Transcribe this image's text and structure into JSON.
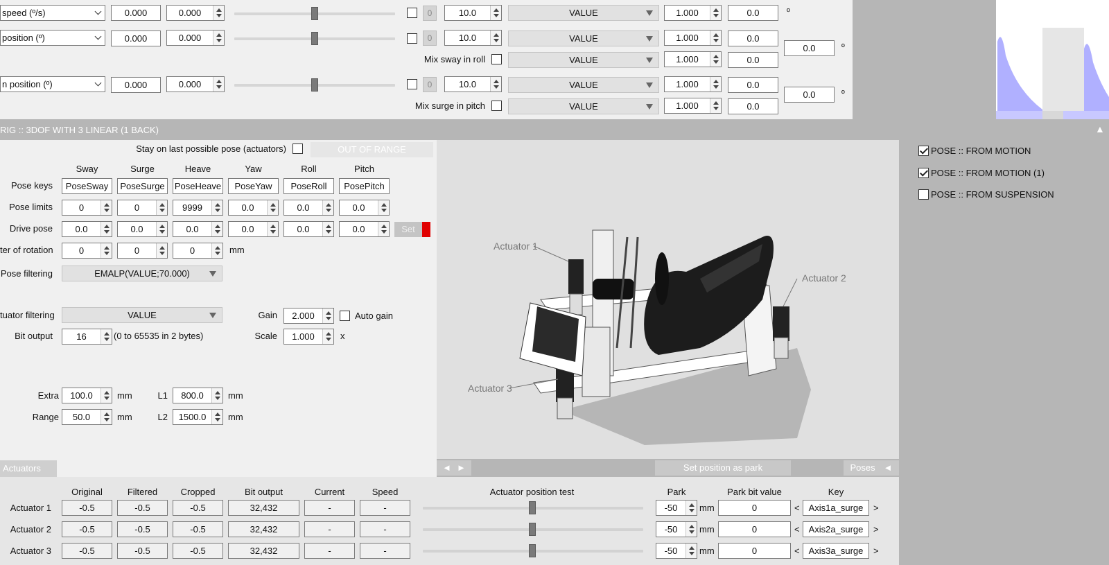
{
  "top": {
    "rows": [
      {
        "axis": "speed (º/s)",
        "a": "0.000",
        "b": "0.000",
        "zero": "0",
        "gain": "10.0",
        "filter": "VALUE",
        "mult": "1.000",
        "out": "0.0"
      },
      {
        "axis": "position (º)",
        "a": "0.000",
        "b": "0.000",
        "zero": "0",
        "gain": "10.0",
        "filter": "VALUE",
        "mult": "1.000",
        "out": "0.0"
      },
      {
        "axis": "n position (º)",
        "a": "0.000",
        "b": "0.000",
        "zero": "0",
        "gain": "10.0",
        "filter": "VALUE",
        "mult": "1.000",
        "out": "0.0"
      }
    ],
    "mix_sway_label": "Mix sway in roll",
    "mix_sway_filter": "VALUE",
    "mix_sway_mult": "1.000",
    "mix_sway_out": "0.0",
    "mix_surge_label": "Mix surge in pitch",
    "mix_surge_filter": "VALUE",
    "mix_surge_mult": "1.000",
    "mix_surge_out": "0.0",
    "sum1": "0.0",
    "sum2": "0.0",
    "deg": "º"
  },
  "rig": {
    "header": "RIG :: 3DOF WITH 3 LINEAR (1 BACK)",
    "stay_label": "Stay on last possible pose (actuators)",
    "out_of_range": "OUT OF RANGE",
    "columns": [
      "Sway",
      "Surge",
      "Heave",
      "Yaw",
      "Roll",
      "Pitch"
    ],
    "pose_keys_label": "Pose keys",
    "pose_keys": [
      "PoseSway",
      "PoseSurge",
      "PoseHeave",
      "PoseYaw",
      "PoseRoll",
      "PosePitch"
    ],
    "pose_limits_label": "Pose limits",
    "pose_limits": [
      "0",
      "0",
      "9999",
      "0.0",
      "0.0",
      "0.0"
    ],
    "drive_pose_label": "Drive pose",
    "drive_pose": [
      "0.0",
      "0.0",
      "0.0",
      "0.0",
      "0.0",
      "0.0"
    ],
    "set_label": "Set",
    "center_label": "ter of rotation",
    "center": [
      "0",
      "0",
      "0"
    ],
    "mm": "mm",
    "pose_filtering_label": "Pose filtering",
    "pose_filtering": "EMALP(VALUE;70.000)",
    "act_filtering_label": "tuator filtering",
    "act_filtering": "VALUE",
    "gain_label": "Gain",
    "gain": "2.000",
    "auto_gain": "Auto gain",
    "bit_output_label": "Bit output",
    "bit_output": "16",
    "bit_range": "(0 to 65535 in 2 bytes)",
    "scale_label": "Scale",
    "scale": "1.000",
    "x": "x",
    "extra_label": "Extra",
    "extra": "100.0",
    "range_label": "Range",
    "range": "50.0",
    "l1_label": "L1",
    "l1": "800.0",
    "l2_label": "L2",
    "l2": "1500.0"
  },
  "view": {
    "act1": "Actuator 1",
    "act2": "Actuator 2",
    "act3": "Actuator 3",
    "set_park": "Set position as park",
    "poses": "Poses",
    "nav_left": "◄",
    "nav_right": "►",
    "poses_arrow": "◄"
  },
  "poses_list": [
    {
      "label": "POSE :: FROM MOTION",
      "checked": true
    },
    {
      "label": "POSE :: FROM MOTION (1)",
      "checked": true
    },
    {
      "label": "POSE :: FROM SUSPENSION",
      "checked": false
    }
  ],
  "actuators": {
    "tab": "Actuators",
    "headers": [
      "Original",
      "Filtered",
      "Cropped",
      "Bit output",
      "Current",
      "Speed"
    ],
    "test_header": "Actuator position test",
    "park_header": "Park",
    "park_bit_header": "Park bit value",
    "key_header": "Key",
    "rows": [
      {
        "name": "Actuator 1",
        "original": "-0.5",
        "filtered": "-0.5",
        "cropped": "-0.5",
        "bit": "32,432",
        "current": "-",
        "speed": "-",
        "park": "-50",
        "park_bit": "0",
        "key": "Axis1a_surge"
      },
      {
        "name": "Actuator 2",
        "original": "-0.5",
        "filtered": "-0.5",
        "cropped": "-0.5",
        "bit": "32,432",
        "current": "-",
        "speed": "-",
        "park": "-50",
        "park_bit": "0",
        "key": "Axis2a_surge"
      },
      {
        "name": "Actuator 3",
        "original": "-0.5",
        "filtered": "-0.5",
        "cropped": "-0.5",
        "bit": "32,432",
        "current": "-",
        "speed": "-",
        "park": "-50",
        "park_bit": "0",
        "key": "Axis3a_surge"
      }
    ],
    "lt": "<",
    "gt": ">"
  },
  "colors": {
    "graph_fill": "#b0b0ff",
    "graph_bg": "#ffffff",
    "accent_red": "#e00000"
  }
}
